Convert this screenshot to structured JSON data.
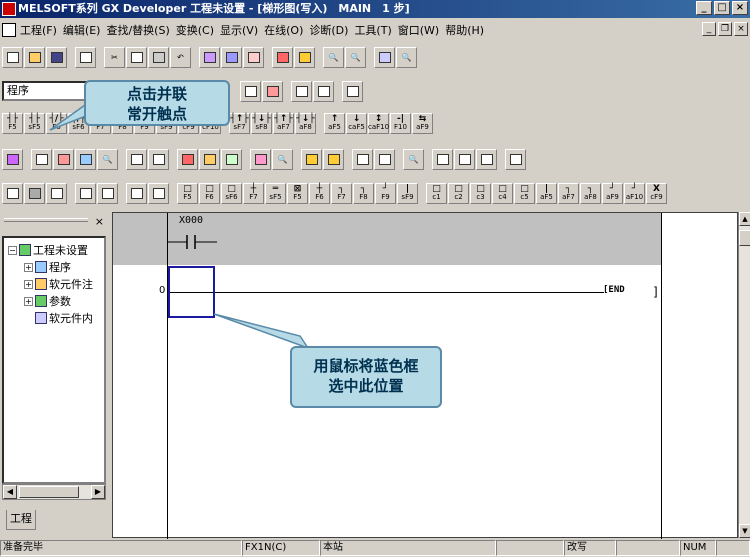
{
  "window": {
    "title": "MELSOFT系列 GX Developer 工程未设置 - [梯形图(写入)　MAIN　1 步]",
    "min": "_",
    "max": "□",
    "close": "×"
  },
  "menu": [
    "工程(F)",
    "编辑(E)",
    "查找/替换(S)",
    "变换(C)",
    "显示(V)",
    "在线(O)",
    "诊断(D)",
    "工具(T)",
    "窗口(W)",
    "帮助(H)"
  ],
  "mdi": {
    "min": "_",
    "restore": "❐",
    "close": "×"
  },
  "combo": {
    "value": "程序",
    "arrow": "▼"
  },
  "keys": [
    {
      "sym": "┤├",
      "label": "F5"
    },
    {
      "sym": "┤├",
      "label": "sF5"
    },
    {
      "sym": "┤/├",
      "label": "F6"
    },
    {
      "sym": "┤/├",
      "label": "sF6"
    },
    {
      "sym": "┤",
      "label": "F7"
    },
    {
      "sym": "{ }",
      "label": "F8"
    },
    {
      "sym": "—",
      "label": "F9"
    },
    {
      "sym": "|",
      "label": "sF9"
    },
    {
      "sym": "—",
      "label": "cF9"
    },
    {
      "sym": "×",
      "label": "cF10"
    },
    {
      "sym": "┤↑├",
      "label": "sF7"
    },
    {
      "sym": "┤↓├",
      "label": "sF8"
    },
    {
      "sym": "┤↑├",
      "label": "aF7"
    },
    {
      "sym": "┤↓├",
      "label": "aF8"
    },
    {
      "sym": "↑",
      "label": "aF5"
    },
    {
      "sym": "↓",
      "label": "caF5"
    },
    {
      "sym": "↕",
      "label": "caF10"
    },
    {
      "sym": "-|",
      "label": "F10"
    },
    {
      "sym": "⇆",
      "label": "aF9"
    }
  ],
  "row5_keys": [
    "F5",
    "F6",
    "sF6",
    "F7",
    "sF5",
    "F5",
    "F6",
    "F7",
    "F8",
    "F9",
    "sF9",
    "c1",
    "c2",
    "c3",
    "c4",
    "c5",
    "aF5",
    "aF7",
    "aF8",
    "aF9",
    "aF10",
    "cF9"
  ],
  "callouts": {
    "top": [
      "点击并联",
      "常开触点"
    ],
    "bottom": [
      "用鼠标将蓝色框",
      "选中此位置"
    ]
  },
  "tree": {
    "root": "工程未设置",
    "items": [
      "程序",
      "软元件注",
      "参数",
      "软元件内"
    ],
    "close": "×",
    "tab": "工程"
  },
  "ladder": {
    "contact_label": "X000",
    "row_number": "0",
    "end_label": "[END",
    "end_bracket": "]"
  },
  "status": {
    "ready": "准备完毕",
    "plc": "FX1N(C)",
    "station": "本站",
    "mode": "改写",
    "num": "NUM"
  }
}
